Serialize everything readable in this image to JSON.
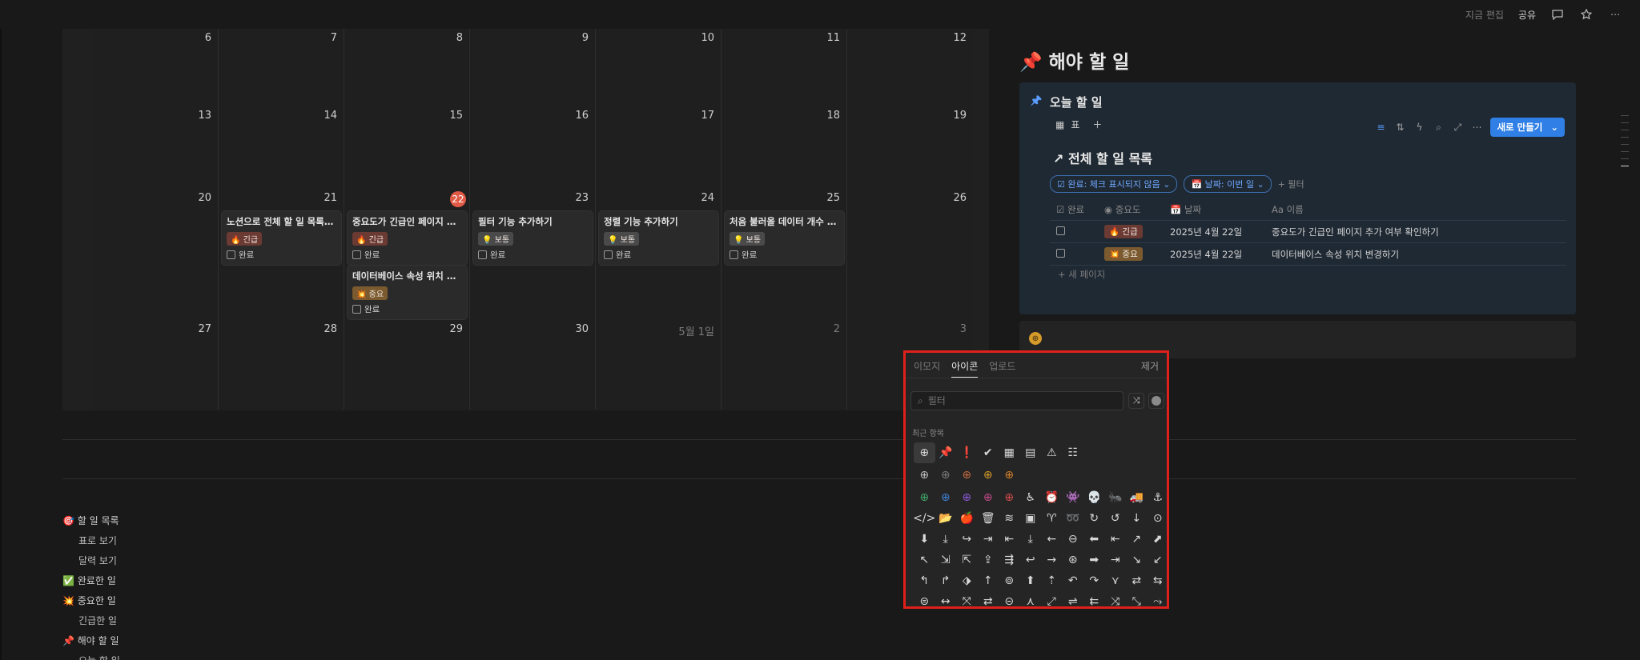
{
  "topbar": {
    "edited": "지금 편집",
    "share": "공유"
  },
  "calendar": {
    "weeks": [
      {
        "days": [
          {
            "n": "6",
            "cards": []
          },
          {
            "n": "7",
            "cards": []
          },
          {
            "n": "8",
            "cards": []
          },
          {
            "n": "9",
            "cards": []
          },
          {
            "n": "10",
            "cards": []
          },
          {
            "n": "11",
            "cards": []
          },
          {
            "n": "12",
            "cards": []
          }
        ]
      },
      {
        "days": [
          {
            "n": "13",
            "cards": []
          },
          {
            "n": "14",
            "cards": []
          },
          {
            "n": "15",
            "cards": []
          },
          {
            "n": "16",
            "cards": []
          },
          {
            "n": "17",
            "cards": []
          },
          {
            "n": "18",
            "cards": []
          },
          {
            "n": "19",
            "cards": []
          }
        ]
      },
      {
        "days": [
          {
            "n": "20",
            "cards": []
          },
          {
            "n": "21",
            "cards": [
              {
                "title": "노션으로 전체 할 일 목록 만...",
                "tag": "🔥 긴급",
                "tagc": "red",
                "chk": "완료"
              }
            ]
          },
          {
            "n": "22",
            "today": true,
            "cards": [
              {
                "title": "중요도가 긴급인 페이지 추...",
                "tag": "🔥 긴급",
                "tagc": "red",
                "chk": "완료"
              },
              {
                "title": "데이터베이스 속성 위치 변...",
                "tag": "💥 중요",
                "tagc": "brown",
                "chk": "완료"
              }
            ]
          },
          {
            "n": "23",
            "cards": [
              {
                "title": "필터 기능 추가하기",
                "tag": "💡 보통",
                "tagc": "gray",
                "chk": "완료"
              }
            ]
          },
          {
            "n": "24",
            "cards": [
              {
                "title": "정렬 기능 추가하기",
                "tag": "💡 보통",
                "tagc": "gray",
                "chk": "완료"
              }
            ]
          },
          {
            "n": "25",
            "cards": [
              {
                "title": "처음 불러올 데이터 개수 지...",
                "tag": "💡 보통",
                "tagc": "gray",
                "chk": "완료"
              }
            ]
          },
          {
            "n": "26",
            "cards": []
          }
        ]
      },
      {
        "days": [
          {
            "n": "27",
            "cards": []
          },
          {
            "n": "28",
            "cards": []
          },
          {
            "n": "29",
            "cards": []
          },
          {
            "n": "30",
            "cards": []
          },
          {
            "n": "5월 1일",
            "muted": true,
            "cards": []
          },
          {
            "n": "2",
            "muted": true,
            "cards": []
          },
          {
            "n": "3",
            "muted": true,
            "cards": []
          }
        ]
      }
    ]
  },
  "toc": [
    {
      "label": "🎯 할 일 목록",
      "sub": false
    },
    {
      "label": "표로 보기",
      "sub": true
    },
    {
      "label": "달력 보기",
      "sub": true
    },
    {
      "label": "✅ 완료한 일",
      "sub": false
    },
    {
      "label": "💥 중요한 일",
      "sub": false
    },
    {
      "label": "긴급한 일",
      "sub": true
    },
    {
      "label": "📌 해야 할 일",
      "sub": false
    },
    {
      "label": "오늘 할 일",
      "sub": true
    }
  ],
  "todo": {
    "title": "📌 해야 할 일",
    "section": "오늘 할 일",
    "view_label": "표",
    "new_button": "새로 만들기",
    "db_title": "↗ 전체 할 일 목록",
    "filters": [
      "☑ 완료: 체크 표시되지 않음 ⌄",
      "📅 날짜: 이번 일 ⌄"
    ],
    "filter_add": "+ 필터",
    "columns": [
      "☑ 완료",
      "◉ 중요도",
      "📅 날짜",
      "Aa 이름"
    ],
    "rows": [
      {
        "tag": "🔥 긴급",
        "tagc": "red",
        "date": "2025년 4월 22일",
        "name": "중요도가 긴급인 페이지 추가 여부 확인하기"
      },
      {
        "tag": "💥 중요",
        "tagc": "brown",
        "date": "2025년 4월 22일",
        "name": "데이터베이스 속성 위치 변경하기"
      }
    ],
    "new_page": "+ 새 페이지"
  },
  "picker": {
    "tabs": [
      "이모지",
      "아이콘",
      "업로드"
    ],
    "active_tab": "아이콘",
    "remove": "제거",
    "search_placeholder": "필터",
    "recent_label": "최근 항목",
    "rows": [
      [
        "⊕",
        "📌",
        "❗",
        "✔",
        "▦",
        "▤",
        "⚠",
        "☷"
      ],
      [
        "⊕",
        "⊕",
        "⊕",
        "⊕",
        "⊕"
      ],
      [
        "⊕",
        "⊕",
        "⊕",
        "⊕",
        "⊕",
        "♿",
        "⏰",
        "👾",
        "💀",
        "🐜",
        "🚚",
        "⚓"
      ],
      [
        "</>",
        "📂",
        "🍎",
        "🗑",
        "≋",
        "▣",
        "♈",
        "➿",
        "↻",
        "↺",
        "↓",
        "⊙"
      ],
      [
        "⬇",
        "⤓",
        "↪",
        "⇥",
        "⇤",
        "⤓",
        "←",
        "⊖",
        "⬅",
        "⇤",
        "↗",
        "⬈"
      ],
      [
        "↖",
        "⇲",
        "⇱",
        "⇪",
        "⇶",
        "↩",
        "→",
        "⊛",
        "➡",
        "⇥",
        "↘",
        "↙"
      ],
      [
        "↰",
        "↱",
        "⬗",
        "↑",
        "⊚",
        "⬆",
        "⇡",
        "↶",
        "↷",
        "⋎",
        "⇄",
        "⇆"
      ],
      [
        "⊜",
        "↔",
        "⤧",
        "⇄",
        "⊝",
        "⋏",
        "⤢",
        "⇌",
        "⇇",
        "⤨",
        "⤡",
        "⤳"
      ]
    ]
  }
}
